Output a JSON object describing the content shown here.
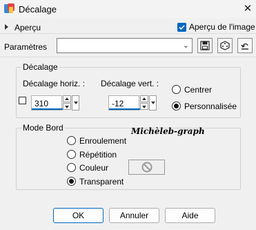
{
  "window": {
    "title": "Décalage",
    "close_glyph": "✕"
  },
  "preview": {
    "toggle_label": "Aperçu",
    "image_preview_label": "Aperçu de l'image",
    "image_preview_checked": true
  },
  "parameters": {
    "label": "Paramètres",
    "preset_value": ""
  },
  "offset_group": {
    "title": "Décalage",
    "horizontal": {
      "label": "Décalage horiz. :",
      "value": "310"
    },
    "vertical": {
      "label": "Décalage vert. :",
      "value": "-12"
    },
    "link_checked": false,
    "options": [
      {
        "label": "Centrer",
        "selected": false
      },
      {
        "label": "Personnalisée",
        "selected": true
      }
    ]
  },
  "edge_group": {
    "title": "Mode Bord",
    "options": [
      {
        "label": "Enroulement",
        "selected": false
      },
      {
        "label": "Répétition",
        "selected": false
      },
      {
        "label": "Couleur",
        "selected": false
      },
      {
        "label": "Transparent",
        "selected": true
      }
    ]
  },
  "watermark": "Michèleb-graph",
  "buttons": {
    "ok": "OK",
    "cancel": "Annuler",
    "help": "Aide"
  },
  "colors": {
    "accent": "#0067c0",
    "background": "#f0f0f0"
  }
}
